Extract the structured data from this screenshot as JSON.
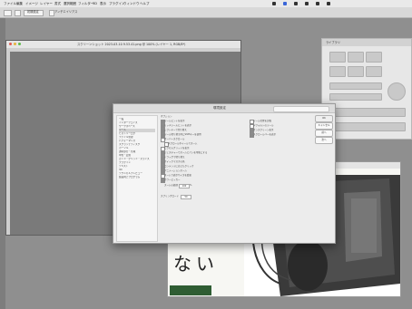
{
  "menubar": {
    "items": [
      "ファイル",
      "編集",
      "イメージ",
      "レイヤー",
      "書式",
      "選択範囲",
      "フィルター",
      "3D",
      "表示",
      "プラグイン",
      "ウィンドウ",
      "ヘルプ"
    ]
  },
  "optionbar": {
    "text1": "初期設定",
    "text2": "アンチエイリアス"
  },
  "doc_window": {
    "title": "スクリーンショット 2023-03-10 9.53.41.png @ 100% (レイヤー 1, RGB/8*)"
  },
  "panel": {
    "title": "ライブラリ"
  },
  "prefs": {
    "title": "環境設定",
    "search_placeholder": "検索",
    "sidebar": [
      "一般",
      "インターフェイス",
      "ワークスペース",
      "ツール",
      "ヒストリーログ",
      "ファイル管理",
      "パフォーマンス",
      "スクラッチディスク",
      "カーソル",
      "透明部分・色域",
      "単位・定規",
      "ガイド・グリッド・スライス",
      "プラグイン",
      "テキスト",
      "3D",
      "テクニカルプレビュー",
      "製品向上プログラム"
    ],
    "section_label": "オプション",
    "options_left": [
      {
        "label": "ツールヒントを表示",
        "checked": true
      },
      {
        "label": "リッチツールヒントを表示",
        "checked": true
      },
      {
        "label": "シフトキーで切り替え",
        "checked": true
      },
      {
        "label": "ツール切り替え時にShiftキーを使用",
        "checked": true
      },
      {
        "label": "オーバースクロール",
        "checked": false
      },
      {
        "label": "スクロールホイールでズーム",
        "checked": false
      },
      {
        "label": "ピクセルグリッドを表示",
        "checked": false
      },
      {
        "label": "ジェスチャーでズームとパンを可能にする",
        "checked": true
      },
      {
        "label": "ドラッグで切り替え",
        "checked": true
      },
      {
        "label": "クイックマスクの色",
        "checked": true
      },
      {
        "label": "コンテンツに応じたクリック",
        "checked": true
      },
      {
        "label": "アニメーションズーム",
        "checked": true
      },
      {
        "label": "ズームで表示サイズを変更",
        "checked": false
      },
      {
        "label": "カラーピッカー",
        "checked": true
      }
    ],
    "options_right": [
      {
        "label": "ツール位置を記憶",
        "checked": false
      },
      {
        "label": "デフォルトのツール",
        "checked": false
      },
      {
        "label": "オンスクリーン表示",
        "checked": true
      },
      {
        "label": "スクロールバーを表示",
        "checked": true
      }
    ],
    "field_label": "ズームの処理",
    "field_value": "100",
    "field_unit": "%",
    "bottom_label": "スプリングロード",
    "bottom_value": "50",
    "buttons": [
      "OK",
      "キャンセル",
      "前へ",
      "次へ"
    ]
  },
  "photo": {
    "text": "ない"
  },
  "colors": {
    "background": "#8f8f8f",
    "dialog": "#ececec",
    "canvas_gray": "#7a7a7a"
  }
}
